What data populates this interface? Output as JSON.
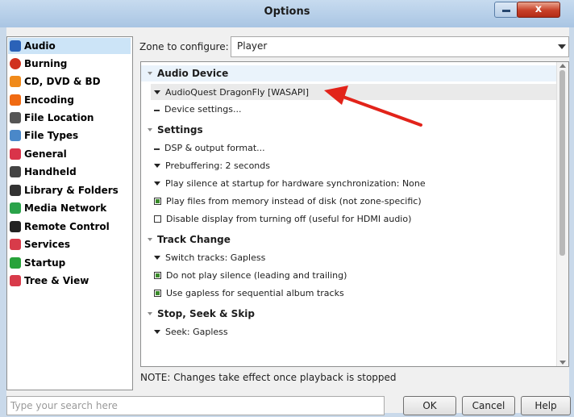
{
  "window": {
    "title": "Options",
    "close_glyph": "x"
  },
  "sidebar": {
    "items": [
      {
        "label": "Audio",
        "icon": "audio-icon",
        "color": "#2b62b8"
      },
      {
        "label": "Burning",
        "icon": "burning-icon",
        "color": "#d0311f"
      },
      {
        "label": "CD, DVD & BD",
        "icon": "disc-icon",
        "color": "#f08a1a"
      },
      {
        "label": "Encoding",
        "icon": "encoding-icon",
        "color": "#f06a12"
      },
      {
        "label": "File Location",
        "icon": "file-location-icon",
        "color": "#555555"
      },
      {
        "label": "File Types",
        "icon": "file-types-icon",
        "color": "#4a88c9"
      },
      {
        "label": "General",
        "icon": "general-icon",
        "color": "#d9344a"
      },
      {
        "label": "Handheld",
        "icon": "handheld-icon",
        "color": "#444444"
      },
      {
        "label": "Library & Folders",
        "icon": "library-icon",
        "color": "#333333"
      },
      {
        "label": "Media Network",
        "icon": "media-network-icon",
        "color": "#2aa34a"
      },
      {
        "label": "Remote Control",
        "icon": "remote-control-icon",
        "color": "#222222"
      },
      {
        "label": "Services",
        "icon": "services-icon",
        "color": "#d83b4a"
      },
      {
        "label": "Startup",
        "icon": "startup-icon",
        "color": "#27a33a"
      },
      {
        "label": "Tree & View",
        "icon": "tree-view-icon",
        "color": "#d83b4a"
      }
    ]
  },
  "zone": {
    "label": "Zone to configure:",
    "value": "Player"
  },
  "tree": {
    "rows": [
      {
        "kind": "section",
        "text": "Audio Device"
      },
      {
        "kind": "chevron",
        "text": "AudioQuest DragonFly [WASAPI]"
      },
      {
        "kind": "dash",
        "text": "Device settings..."
      },
      {
        "kind": "section",
        "text": "Settings"
      },
      {
        "kind": "dash",
        "text": "DSP & output format..."
      },
      {
        "kind": "chevron",
        "text": "Prebuffering: 2 seconds"
      },
      {
        "kind": "chevron",
        "text": "Play silence at startup for hardware synchronization: None"
      },
      {
        "kind": "check-on",
        "text": "Play files from memory instead of disk (not zone-specific)"
      },
      {
        "kind": "check-off",
        "text": "Disable display from turning off (useful for HDMI audio)"
      },
      {
        "kind": "section",
        "text": "Track Change"
      },
      {
        "kind": "chevron",
        "text": "Switch tracks: Gapless"
      },
      {
        "kind": "check-on",
        "text": "Do not play silence (leading and trailing)"
      },
      {
        "kind": "check-on",
        "text": "Use gapless for sequential album tracks"
      },
      {
        "kind": "section",
        "text": "Stop, Seek & Skip"
      },
      {
        "kind": "chevron",
        "text": "Seek: Gapless"
      }
    ]
  },
  "note": "NOTE: Changes take effect once playback is stopped",
  "search": {
    "placeholder": "Type your search here"
  },
  "buttons": {
    "ok": "OK",
    "cancel": "Cancel",
    "help": "Help"
  },
  "colors": {
    "annotation_arrow": "#e2231a",
    "selection": "#cce4f7"
  }
}
